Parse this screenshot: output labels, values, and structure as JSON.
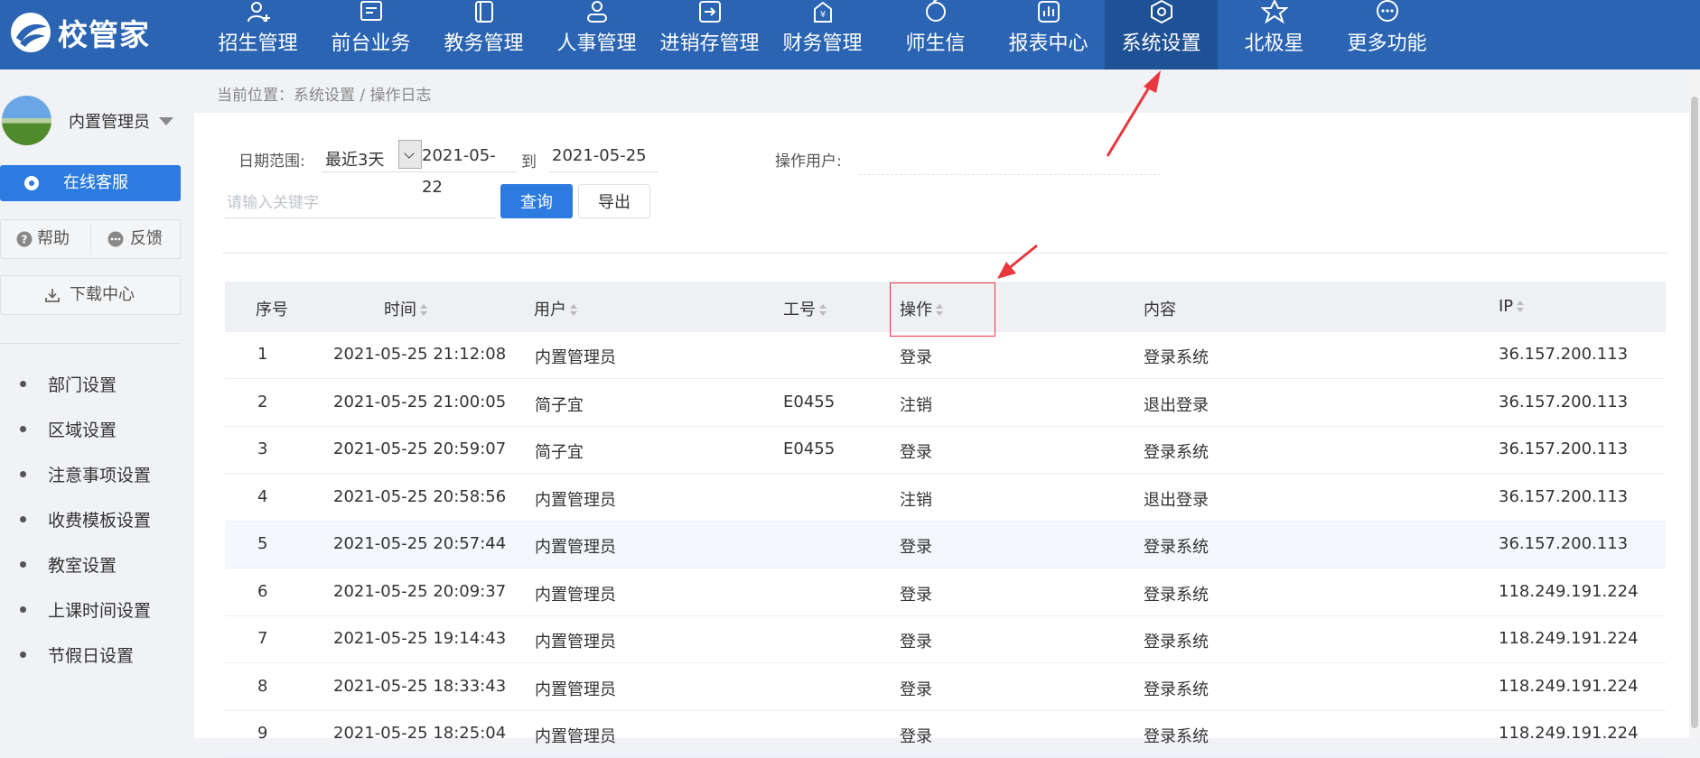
{
  "app": {
    "logo_text": "校管家"
  },
  "nav": [
    {
      "label": "招生管理",
      "icon": "user-add-icon"
    },
    {
      "label": "前台业务",
      "icon": "monitor-icon"
    },
    {
      "label": "教务管理",
      "icon": "book-icon"
    },
    {
      "label": "人事管理",
      "icon": "person-icon"
    },
    {
      "label": "进销存管理",
      "icon": "inventory-icon"
    },
    {
      "label": "财务管理",
      "icon": "yen-bag-icon"
    },
    {
      "label": "师生信",
      "icon": "chat-bubble-icon"
    },
    {
      "label": "报表中心",
      "icon": "bar-chart-icon"
    },
    {
      "label": "系统设置",
      "icon": "settings-icon",
      "active": true
    },
    {
      "label": "北极星",
      "icon": "star-icon"
    },
    {
      "label": "更多功能",
      "icon": "more-icon"
    }
  ],
  "sidebar": {
    "user_name": "内置管理员",
    "service_label": "在线客服",
    "help_label": "帮助",
    "feedback_label": "反馈",
    "download_label": "下载中心",
    "menu": [
      "部门设置",
      "区域设置",
      "注意事项设置",
      "收费模板设置",
      "教室设置",
      "上课时间设置",
      "节假日设置"
    ]
  },
  "breadcrumb": "当前位置：系统设置 / 操作日志",
  "filters": {
    "date_range_label": "日期范围:",
    "range_value": "最近3天",
    "start_date": "2021-05-22",
    "to_label": "到",
    "end_date": "2021-05-25",
    "operator_label": "操作用户:",
    "keyword_placeholder": "请输入关键字",
    "query_label": "查询",
    "export_label": "导出"
  },
  "table": {
    "headers": {
      "index": "序号",
      "time": "时间",
      "user": "用户",
      "emp_no": "工号",
      "action": "操作",
      "content": "内容",
      "ip": "IP"
    },
    "rows": [
      {
        "index": "1",
        "time": "2021-05-25 21:12:08",
        "user": "内置管理员",
        "emp_no": "",
        "action": "登录",
        "content": "登录系统",
        "ip": "36.157.200.113"
      },
      {
        "index": "2",
        "time": "2021-05-25 21:00:05",
        "user": "简子宜",
        "emp_no": "E0455",
        "action": "注销",
        "content": "退出登录",
        "ip": "36.157.200.113"
      },
      {
        "index": "3",
        "time": "2021-05-25 20:59:07",
        "user": "简子宜",
        "emp_no": "E0455",
        "action": "登录",
        "content": "登录系统",
        "ip": "36.157.200.113"
      },
      {
        "index": "4",
        "time": "2021-05-25 20:58:56",
        "user": "内置管理员",
        "emp_no": "",
        "action": "注销",
        "content": "退出登录",
        "ip": "36.157.200.113"
      },
      {
        "index": "5",
        "time": "2021-05-25 20:57:44",
        "user": "内置管理员",
        "emp_no": "",
        "action": "登录",
        "content": "登录系统",
        "ip": "36.157.200.113"
      },
      {
        "index": "6",
        "time": "2021-05-25 20:09:37",
        "user": "内置管理员",
        "emp_no": "",
        "action": "登录",
        "content": "登录系统",
        "ip": "118.249.191.224"
      },
      {
        "index": "7",
        "time": "2021-05-25 19:14:43",
        "user": "内置管理员",
        "emp_no": "",
        "action": "登录",
        "content": "登录系统",
        "ip": "118.249.191.224"
      },
      {
        "index": "8",
        "time": "2021-05-25 18:33:43",
        "user": "内置管理员",
        "emp_no": "",
        "action": "登录",
        "content": "登录系统",
        "ip": "118.249.191.224"
      },
      {
        "index": "9",
        "time": "2021-05-25 18:25:04",
        "user": "内置管理员",
        "emp_no": "",
        "action": "登录",
        "content": "登录系统",
        "ip": "118.249.191.224"
      }
    ]
  },
  "colors": {
    "header_bg": "#2a64b3",
    "active_nav_bg": "#1e5196",
    "primary": "#2b7be0",
    "annotation": "#e8383d"
  }
}
